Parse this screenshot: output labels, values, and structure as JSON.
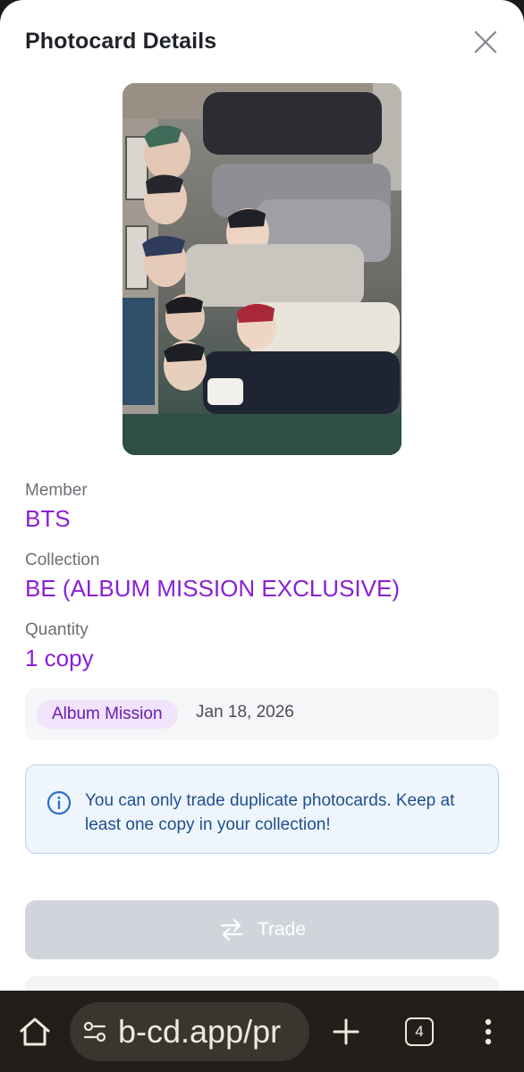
{
  "modal": {
    "title": "Photocard Details"
  },
  "photocard": {
    "image_alt": "BTS group photocard"
  },
  "details": {
    "member_label": "Member",
    "member_value": "BTS",
    "collection_label": "Collection",
    "collection_value": "BE (ALBUM MISSION EXCLUSIVE)",
    "quantity_label": "Quantity",
    "quantity_value": "1 copy"
  },
  "meta": {
    "badge": "Album Mission",
    "date": "Jan 18, 2026"
  },
  "notice": {
    "text": "You can only trade duplicate photocards. Keep at least one copy in your collection!"
  },
  "actions": {
    "trade_label": "Trade"
  },
  "browser": {
    "url": "b-cd.app/pr",
    "tab_count": "4"
  },
  "colors": {
    "accent": "#8a1fd4",
    "badge_bg": "#f1e3fb",
    "info_bg": "#eef5fd",
    "disabled_button": "#d1d5db",
    "browser_bar": "#221f1a"
  }
}
